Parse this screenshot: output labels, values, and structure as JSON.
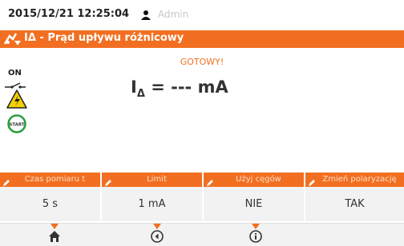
{
  "status": {
    "datetime": "2015/12/21 12:25:04",
    "user": "Admin"
  },
  "title": {
    "text": "IΔ - Prąd upływu różnicowy",
    "icon": "rcd-icon"
  },
  "indicators": {
    "on_label": "ON",
    "start_label": "START"
  },
  "measurement": {
    "status": "GOTOWY!",
    "symbol": "I",
    "subscript": "Δ",
    "value": " = --- mA"
  },
  "params": [
    {
      "label": "Czas pomiaru t",
      "value": "5 s"
    },
    {
      "label": "Limit",
      "value": "1 mA"
    },
    {
      "label": "Użyj cęgów",
      "value": "NIE"
    },
    {
      "label": "Zmień polaryzację",
      "value": "TAK"
    }
  ],
  "nav": {
    "icons": [
      "home-icon",
      "back-icon",
      "info-icon"
    ]
  },
  "colors": {
    "accent": "#f26f21",
    "panel": "#f2f2f2",
    "hv_yellow": "#f5d000",
    "start_green": "#2a9d3a"
  }
}
